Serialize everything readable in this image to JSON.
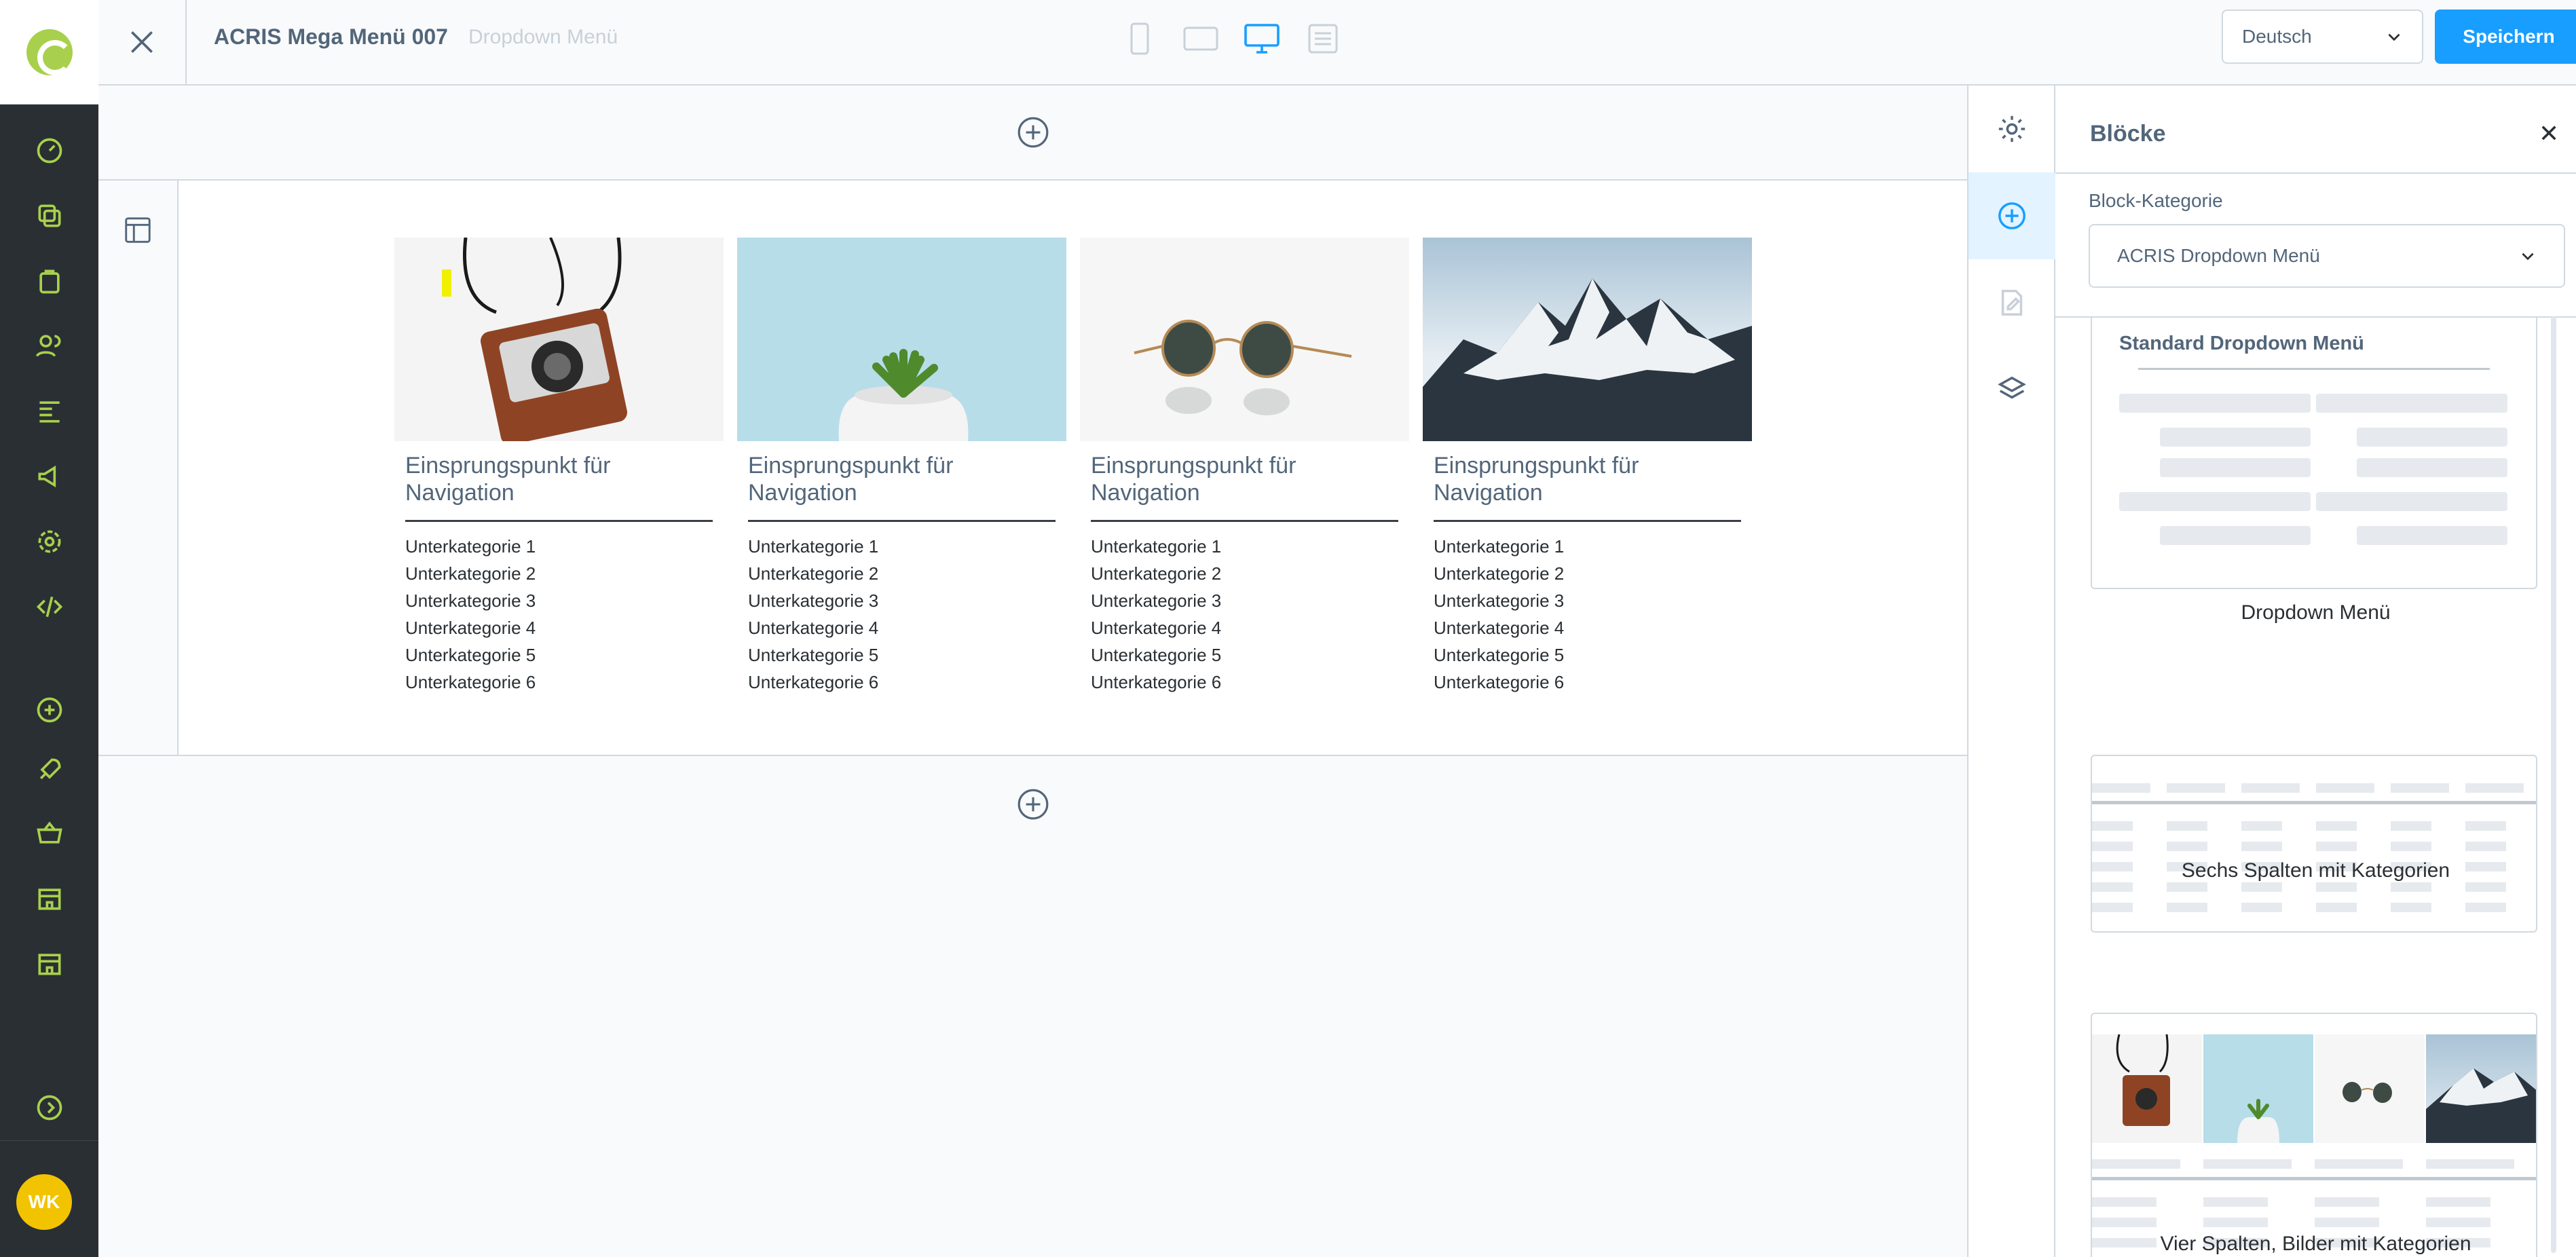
{
  "app": {
    "page_title": "ACRIS Mega Menü 007",
    "page_subtitle": "Dropdown Menü"
  },
  "topbar": {
    "language": "Deutsch",
    "save_label": "Speichern"
  },
  "user": {
    "initials": "WK"
  },
  "canvas": {
    "columns": [
      {
        "title": "Einsprungspunkt für Navigation",
        "image": "camera",
        "items": [
          "Unterkategorie 1",
          "Unterkategorie 2",
          "Unterkategorie 3",
          "Unterkategorie 4",
          "Unterkategorie 5",
          "Unterkategorie 6"
        ]
      },
      {
        "title": "Einsprungspunkt für Navigation",
        "image": "plant",
        "items": [
          "Unterkategorie 1",
          "Unterkategorie 2",
          "Unterkategorie 3",
          "Unterkategorie 4",
          "Unterkategorie 5",
          "Unterkategorie 6"
        ]
      },
      {
        "title": "Einsprungspunkt für Navigation",
        "image": "sunglasses",
        "items": [
          "Unterkategorie 1",
          "Unterkategorie 2",
          "Unterkategorie 3",
          "Unterkategorie 4",
          "Unterkategorie 5",
          "Unterkategorie 6"
        ]
      },
      {
        "title": "Einsprungspunkt für Navigation",
        "image": "mountains",
        "items": [
          "Unterkategorie 1",
          "Unterkategorie 2",
          "Unterkategorie 3",
          "Unterkategorie 4",
          "Unterkategorie 5",
          "Unterkategorie 6"
        ]
      }
    ]
  },
  "sidebar": {
    "title": "Blöcke",
    "category_label": "Block-Kategorie",
    "category_value": "ACRIS Dropdown Menü",
    "blocks": [
      {
        "preview_heading": "Standard Dropdown Menü",
        "name": "Dropdown Menü"
      },
      {
        "name": "Sechs Spalten mit Kategorien"
      },
      {
        "name": "Vier Spalten, Bilder mit Kategorien"
      }
    ]
  },
  "colors": {
    "accent": "#189eff",
    "nav_bg": "#2a2f33",
    "brand": "#a8d04c",
    "avatar": "#f2c300"
  }
}
